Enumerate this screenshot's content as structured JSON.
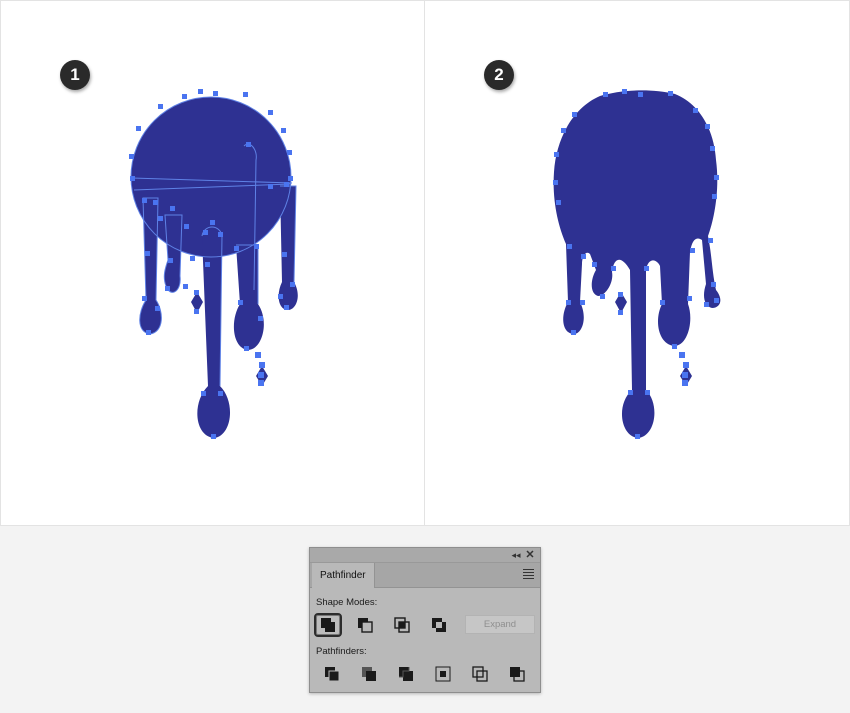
{
  "steps": [
    {
      "number": "1",
      "description": "overlapping shapes with path anchors"
    },
    {
      "number": "2",
      "description": "merged single shape"
    }
  ],
  "colors": {
    "shape_fill": "#2e3192",
    "anchor": "#4a74f0",
    "badge": "#2a2a2a",
    "panel_bg": "#b9b9b9"
  },
  "pathfinder_panel": {
    "tab_label": "Pathfinder",
    "collapse_glyph": "◂◂",
    "close_glyph": "✕",
    "shape_modes_label": "Shape Modes:",
    "expand_label": "Expand",
    "pathfinders_label": "Pathfinders:",
    "shape_modes": [
      {
        "name": "unite-icon",
        "selected": true
      },
      {
        "name": "minus-front-icon",
        "selected": false
      },
      {
        "name": "intersect-icon",
        "selected": false
      },
      {
        "name": "exclude-icon",
        "selected": false
      }
    ],
    "pathfinders": [
      {
        "name": "divide-icon"
      },
      {
        "name": "trim-icon"
      },
      {
        "name": "merge-icon"
      },
      {
        "name": "crop-icon"
      },
      {
        "name": "outline-icon"
      },
      {
        "name": "minus-back-icon"
      }
    ]
  }
}
